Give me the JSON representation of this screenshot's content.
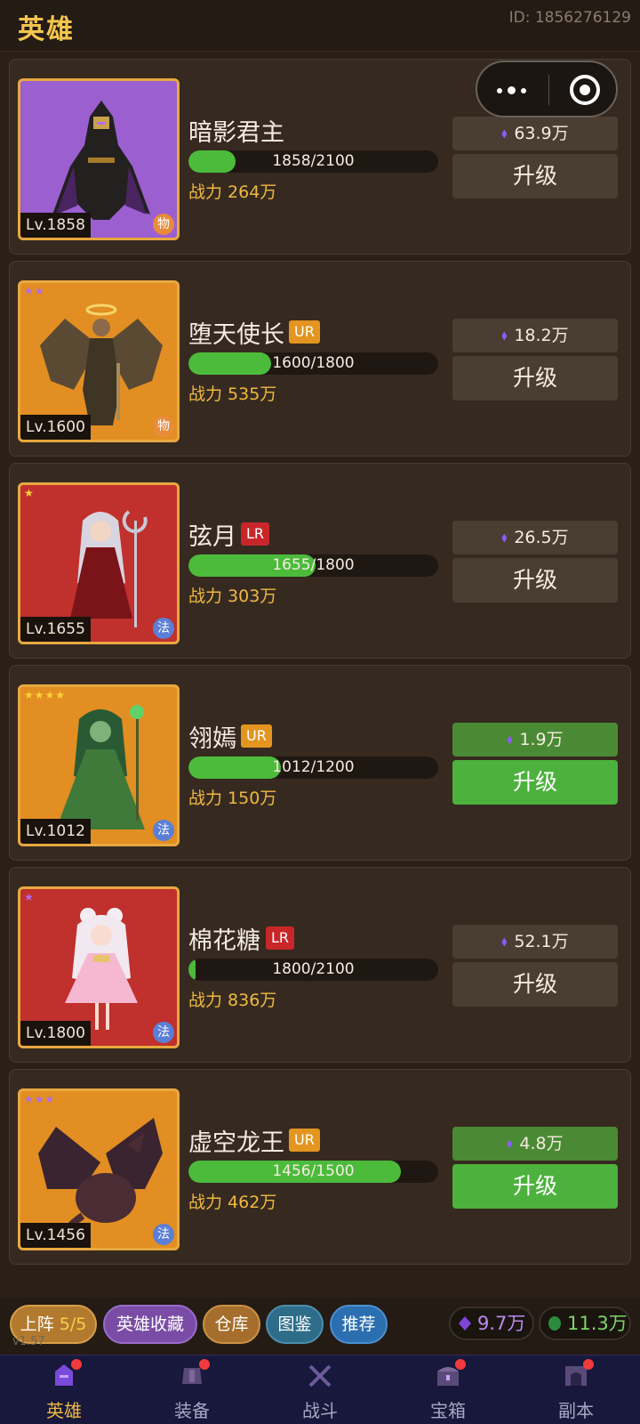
{
  "header": {
    "title": "英雄",
    "user_id": "ID: 1856276129"
  },
  "heroes": [
    {
      "name": "暗影君主",
      "rarity": "",
      "level": "Lv.1858",
      "exp": "1858/2100",
      "exp_fill": 0.19,
      "power": "战力 264万",
      "cost": "63.9万",
      "upgrade": "升级",
      "type": "物",
      "stars": "",
      "upgrade_enabled": false
    },
    {
      "name": "堕天使长",
      "rarity": "UR",
      "level": "Lv.1600",
      "exp": "1600/1800",
      "exp_fill": 0.33,
      "power": "战力 535万",
      "cost": "18.2万",
      "upgrade": "升级",
      "type": "物",
      "stars": "★★",
      "upgrade_enabled": false
    },
    {
      "name": "弦月",
      "rarity": "LR",
      "level": "Lv.1655",
      "exp": "1655/1800",
      "exp_fill": 0.51,
      "power": "战力 303万",
      "cost": "26.5万",
      "upgrade": "升级",
      "type": "法",
      "stars": "★",
      "upgrade_enabled": false
    },
    {
      "name": "翎嫣",
      "rarity": "UR",
      "level": "Lv.1012",
      "exp": "1012/1200",
      "exp_fill": 0.37,
      "power": "战力 150万",
      "cost": "1.9万",
      "upgrade": "升级",
      "type": "法",
      "stars": "★★★★",
      "upgrade_enabled": true
    },
    {
      "name": "棉花糖",
      "rarity": "LR",
      "level": "Lv.1800",
      "exp": "1800/2100",
      "exp_fill": 0.03,
      "power": "战力 836万",
      "cost": "52.1万",
      "upgrade": "升级",
      "type": "法",
      "stars": "★",
      "upgrade_enabled": false
    },
    {
      "name": "虚空龙王",
      "rarity": "UR",
      "level": "Lv.1456",
      "exp": "1456/1500",
      "exp_fill": 0.85,
      "power": "战力 462万",
      "cost": "4.8万",
      "upgrade": "升级",
      "type": "法",
      "stars": "★★★",
      "upgrade_enabled": true
    }
  ],
  "filters": {
    "lineup_label": "上阵",
    "lineup_count": "5/5",
    "collection": "英雄收藏",
    "warehouse": "仓库",
    "codex": "图鉴",
    "recommend": "推荐"
  },
  "resources": {
    "gems": "9.7万",
    "coins": "11.3万"
  },
  "version": "v1.57",
  "tabs": [
    {
      "label": "英雄",
      "active": true,
      "badge": true
    },
    {
      "label": "装备",
      "active": false,
      "badge": true
    },
    {
      "label": "战斗",
      "active": false,
      "badge": false
    },
    {
      "label": "宝箱",
      "active": false,
      "badge": true
    },
    {
      "label": "副本",
      "active": false,
      "badge": true
    }
  ]
}
